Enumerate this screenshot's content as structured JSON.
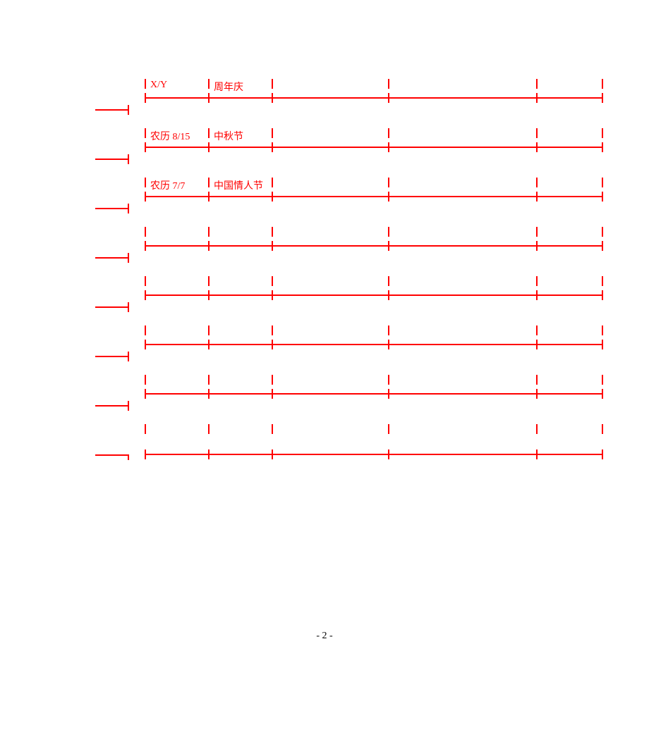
{
  "rows": [
    {
      "col1": "X/Y",
      "col2": "周年庆",
      "col3": "",
      "col4": "",
      "col5": ""
    },
    {
      "col1": "农历 8/15",
      "col2": "中秋节",
      "col3": "",
      "col4": "",
      "col5": ""
    },
    {
      "col1": "农历 7/7",
      "col2": "中国情人节",
      "col3": "",
      "col4": "",
      "col5": ""
    },
    {
      "col1": "",
      "col2": "",
      "col3": "",
      "col4": "",
      "col5": ""
    },
    {
      "col1": "",
      "col2": "",
      "col3": "",
      "col4": "",
      "col5": ""
    },
    {
      "col1": "",
      "col2": "",
      "col3": "",
      "col4": "",
      "col5": ""
    },
    {
      "col1": "",
      "col2": "",
      "col3": "",
      "col4": "",
      "col5": ""
    },
    {
      "col1": "",
      "col2": "",
      "col3": "",
      "col4": "",
      "col5": ""
    }
  ],
  "col_positions": [
    0,
    90,
    180,
    345,
    555,
    648
  ],
  "page_number": "- 2 -"
}
